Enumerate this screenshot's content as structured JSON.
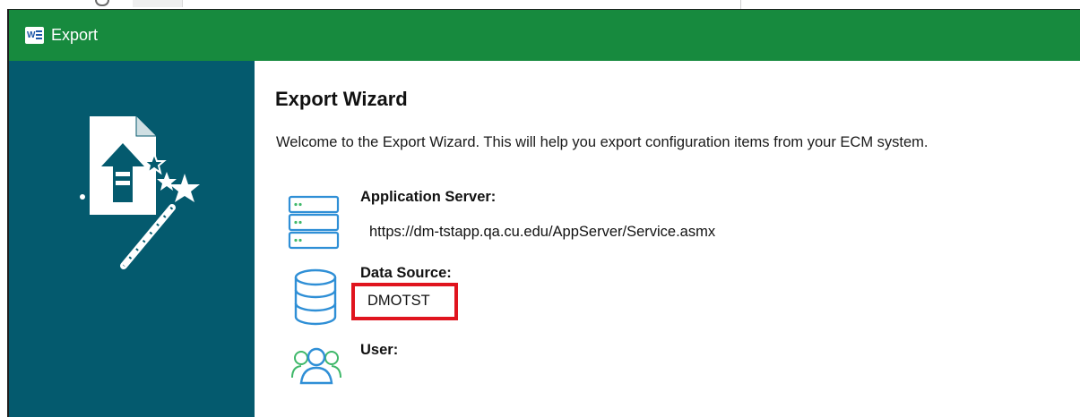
{
  "window": {
    "title": "Export",
    "app_icon": "word-document-icon",
    "titlebar_color": "#178a3e"
  },
  "sidebar": {
    "background": "#045a6e",
    "illustration": "export-wizard-magic-wand-icon"
  },
  "main": {
    "heading": "Export Wizard",
    "welcome": "Welcome to the Export Wizard. This will help you export configuration items from your ECM system.",
    "application_server": {
      "label": "Application Server:",
      "value": "https://dm-tstapp.qa.cu.edu/AppServer/Service.asmx",
      "icon": "server-icon"
    },
    "data_source": {
      "label": "Data Source:",
      "value": "DMOTST",
      "icon": "database-icon",
      "highlight_color": "#e0141e"
    },
    "user": {
      "label": "User:",
      "value": "",
      "icon": "users-icon"
    }
  }
}
